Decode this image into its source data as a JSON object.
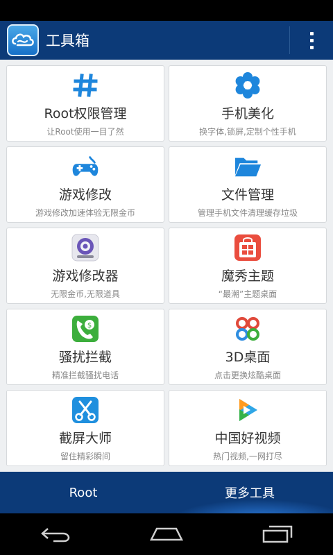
{
  "app": {
    "title": "工具箱"
  },
  "colors": {
    "accent": "#0c3a78",
    "icon_blue": "#1e86dc"
  },
  "tools": [
    {
      "title": "Root权限管理",
      "subtitle": "让Root使用一目了然",
      "icon": "hash-icon"
    },
    {
      "title": "手机美化",
      "subtitle": "换字体,锁屏,定制个性手机",
      "icon": "flower-icon"
    },
    {
      "title": "游戏修改",
      "subtitle": "游戏修改加速体验无限金币",
      "icon": "gamepad-icon"
    },
    {
      "title": "文件管理",
      "subtitle": "管理手机文件清理缓存垃圾",
      "icon": "folder-icon"
    },
    {
      "title": "游戏修改器",
      "subtitle": "无限金币,无限道具",
      "icon": "game-modifier-app-icon"
    },
    {
      "title": "魔秀主题",
      "subtitle": "“最潮”主题桌面",
      "icon": "moxiu-theme-app-icon"
    },
    {
      "title": "骚扰拦截",
      "subtitle": "精准拦截骚扰电话",
      "icon": "call-block-app-icon"
    },
    {
      "title": "3D桌面",
      "subtitle": "点击更换炫酷桌面",
      "icon": "3d-desktop-app-icon"
    },
    {
      "title": "截屏大师",
      "subtitle": "留住精彩瞬间",
      "icon": "screenshot-app-icon"
    },
    {
      "title": "中国好视频",
      "subtitle": "热门视频,一网打尽",
      "icon": "video-app-icon"
    }
  ],
  "bottom_tabs": [
    {
      "label": "Root"
    },
    {
      "label": "更多工具"
    }
  ],
  "nav": {
    "back": "back-icon",
    "home": "home-icon",
    "recents": "recents-icon"
  }
}
